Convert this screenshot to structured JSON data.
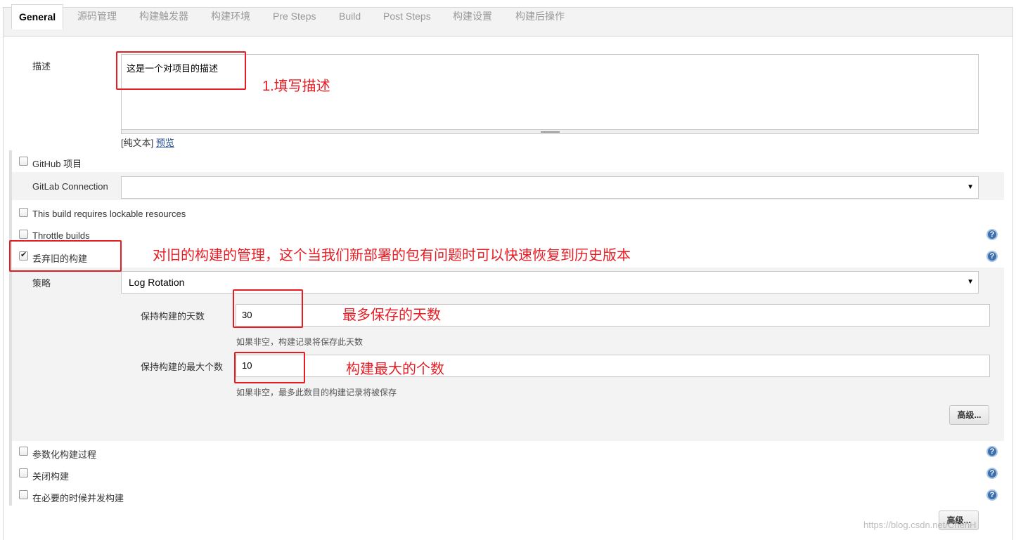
{
  "tabs": [
    "General",
    "源码管理",
    "构建触发器",
    "构建环境",
    "Pre Steps",
    "Build",
    "Post Steps",
    "构建设置",
    "构建后操作"
  ],
  "description": {
    "label": "描述",
    "value": "这是一个对项目的描述",
    "plain_text": "[纯文本]",
    "preview": "预览"
  },
  "options": {
    "github_project": "GitHub 项目",
    "gitlab_connection": "GitLab Connection",
    "lockable": "This build requires lockable resources",
    "throttle": "Throttle builds",
    "discard_old": "丢弃旧的构建",
    "parameterized": "参数化构建过程",
    "disable": "关闭构建",
    "concurrent": "在必要的时候并发构建"
  },
  "strategy": {
    "label": "策略",
    "value": "Log Rotation",
    "days_label": "保持构建的天数",
    "days_value": "30",
    "days_hint": "如果非空，构建记录将保存此天数",
    "max_label": "保持构建的最大个数",
    "max_value": "10",
    "max_hint": "如果非空，最多此数目的构建记录将被保存",
    "advanced": "高级..."
  },
  "advanced_bottom": "高级...",
  "annotations": {
    "fill_desc": "1.填写描述",
    "discard_note": "对旧的构建的管理，这个当我们新部署的包有问题时可以快速恢复到历史版本",
    "max_days": "最多保存的天数",
    "max_count": "构建最大的个数"
  },
  "watermark": "https://blog.csdn.net/ChenH",
  "colors": {
    "annotation": "#e51c23",
    "help_icon": "#3b6fb0"
  }
}
